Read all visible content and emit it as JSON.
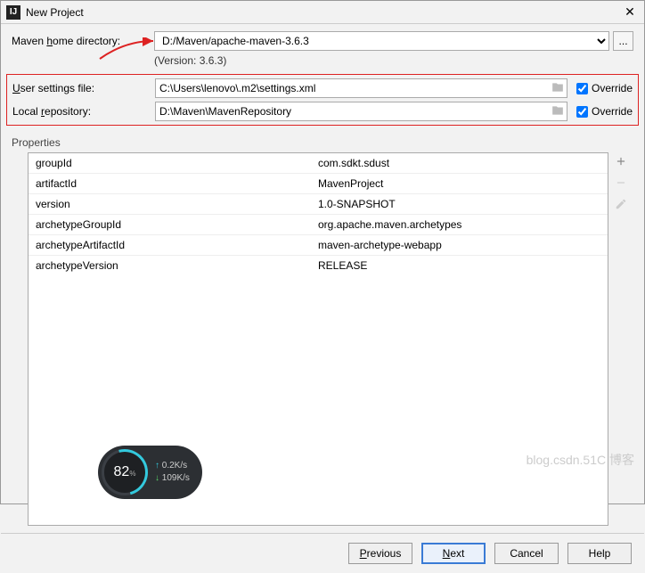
{
  "window": {
    "title": "New Project"
  },
  "fields": {
    "maven_home_label": "Maven home directory:",
    "maven_home_value": "D:/Maven/apache-maven-3.6.3",
    "version_text": "(Version: 3.6.3)",
    "user_settings_label": "User settings file:",
    "user_settings_value": "C:\\Users\\lenovo\\.m2\\settings.xml",
    "local_repo_label": "Local repository:",
    "local_repo_value": "D:\\Maven\\MavenRepository",
    "override_label": "Override",
    "override_user": true,
    "override_repo": true
  },
  "properties": {
    "header": "Properties",
    "rows": [
      {
        "key": "groupId",
        "value": "com.sdkt.sdust"
      },
      {
        "key": "artifactId",
        "value": "MavenProject"
      },
      {
        "key": "version",
        "value": "1.0-SNAPSHOT"
      },
      {
        "key": "archetypeGroupId",
        "value": "org.apache.maven.archetypes"
      },
      {
        "key": "archetypeArtifactId",
        "value": "maven-archetype-webapp"
      },
      {
        "key": "archetypeVersion",
        "value": "RELEASE"
      }
    ]
  },
  "buttons": {
    "previous": "Previous",
    "next": "Next",
    "cancel": "Cancel",
    "help": "Help",
    "browse": "..."
  },
  "widget": {
    "percent": "82",
    "percent_unit": "%",
    "up": "0.2K/s",
    "down": "109K/s"
  },
  "watermark": "blog.csdn.51C 博客"
}
